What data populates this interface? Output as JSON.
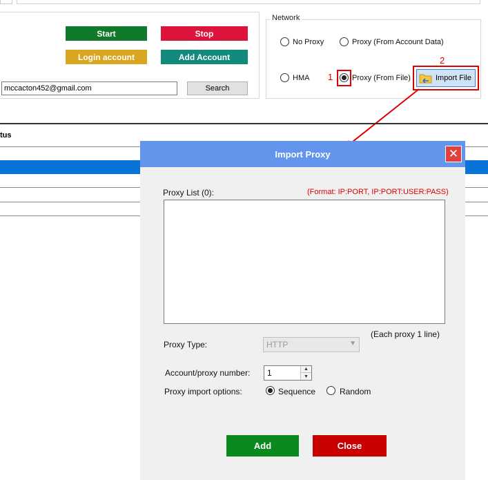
{
  "toolbar": {
    "start_label": "Start",
    "stop_label": "Stop",
    "login_label": "Login account",
    "add_account_label": "Add Account",
    "email_value": "mccacton452@gmail.com",
    "search_label": "Search",
    "colors": {
      "start": "#117a2a",
      "stop": "#dc143c",
      "login": "#daa520",
      "add_account": "#138a7e"
    }
  },
  "network": {
    "title": "Network",
    "options": {
      "no_proxy": "No Proxy",
      "from_account": "Proxy (From Account Data)",
      "hma": "HMA",
      "from_file": "Proxy (From File)"
    },
    "selected": "from_file",
    "import_file_label": "Import File",
    "annotation_1": "1",
    "annotation_2": "2"
  },
  "grid": {
    "status_header": "tus"
  },
  "dialog": {
    "title": "Import Proxy",
    "close_icon": "close-icon",
    "proxy_list_label": "Proxy List (0):",
    "format_hint": "(Format: IP:PORT, IP:PORT:USER:PASS)",
    "proxy_list_value": "",
    "each_proxy_hint": "(Each proxy 1 line)",
    "proxy_type_label": "Proxy Type:",
    "proxy_type_value": "HTTP",
    "account_proxy_label": "Account/proxy number:",
    "account_proxy_value": "1",
    "import_options_label": "Proxy import options:",
    "option_sequence": "Sequence",
    "option_random": "Random",
    "selected_option": "sequence",
    "add_label": "Add",
    "close_label": "Close",
    "accent": "#6495ed"
  }
}
